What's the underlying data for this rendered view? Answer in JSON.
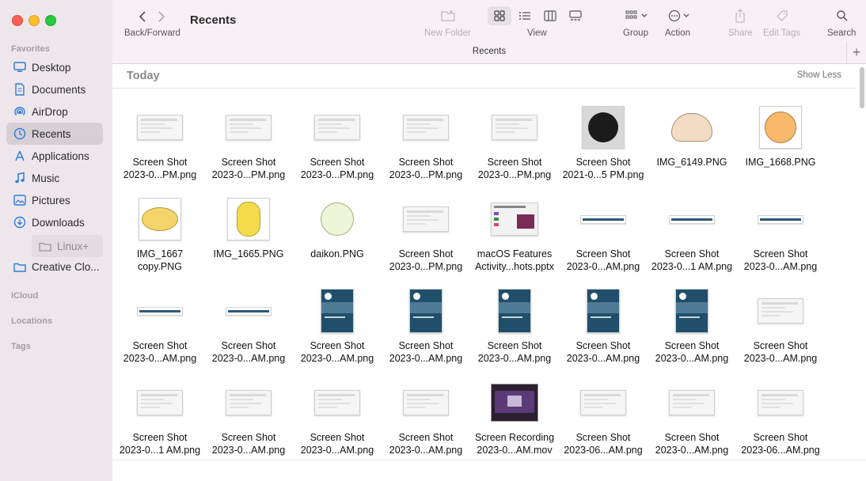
{
  "window": {
    "title": "Recents"
  },
  "colors": {
    "sidebar_bg": "#ede7ec",
    "accent": "#2f7bd9",
    "close": "#fe5f57",
    "minimize": "#febc2e",
    "zoom": "#28c840"
  },
  "sidebar": {
    "favorites_header": "Favorites",
    "items": [
      {
        "label": "Desktop",
        "icon": "desktop-icon"
      },
      {
        "label": "Documents",
        "icon": "document-icon"
      },
      {
        "label": "AirDrop",
        "icon": "airdrop-icon"
      },
      {
        "label": "Recents",
        "icon": "clock-icon",
        "selected": true
      },
      {
        "label": "Applications",
        "icon": "applications-icon"
      },
      {
        "label": "Music",
        "icon": "music-note-icon"
      },
      {
        "label": "Pictures",
        "icon": "photo-icon"
      },
      {
        "label": "Downloads",
        "icon": "download-icon"
      },
      {
        "label": "Linux+",
        "icon": "folder-icon",
        "dimmed": true
      },
      {
        "label": "Creative Clo...",
        "icon": "folder-icon"
      }
    ],
    "icloud_header": "iCloud",
    "locations_header": "Locations",
    "tags_header": "Tags"
  },
  "toolbar": {
    "title": "Recents",
    "back_forward_label": "Back/Forward",
    "new_folder_label": "New Folder",
    "view_label": "View",
    "group_label": "Group",
    "action_label": "Action",
    "share_label": "Share",
    "edit_tags_label": "Edit Tags",
    "search_label": "Search",
    "tab_title": "Recents",
    "view_mode": "icon"
  },
  "content": {
    "section_title": "Today",
    "show_less": "Show Less",
    "files": [
      {
        "line1": "Screen Shot",
        "line2": "2023-0...PM.png",
        "thumb": "shot"
      },
      {
        "line1": "Screen Shot",
        "line2": "2023-0...PM.png",
        "thumb": "shot"
      },
      {
        "line1": "Screen Shot",
        "line2": "2023-0...PM.png",
        "thumb": "shot"
      },
      {
        "line1": "Screen Shot",
        "line2": "2023-0...PM.png",
        "thumb": "shot"
      },
      {
        "line1": "Screen Shot",
        "line2": "2023-0...PM.png",
        "thumb": "shot"
      },
      {
        "line1": "Screen Shot",
        "line2": "2021-0...5 PM.png",
        "thumb": "logo"
      },
      {
        "line1": "IMG_6149.PNG",
        "line2": "",
        "thumb": "mushroom"
      },
      {
        "line1": "IMG_1668.PNG",
        "line2": "",
        "thumb": "onion"
      },
      {
        "line1": "IMG_1667",
        "line2": "copy.PNG",
        "thumb": "potato"
      },
      {
        "line1": "IMG_1665.PNG",
        "line2": "",
        "thumb": "banana"
      },
      {
        "line1": "daikon.PNG",
        "line2": "",
        "thumb": "daikon"
      },
      {
        "line1": "Screen Shot",
        "line2": "2023-0...PM.png",
        "thumb": "shot"
      },
      {
        "line1": "macOS Features",
        "line2": "Activity...hots.pptx",
        "thumb": "pptx"
      },
      {
        "line1": "Screen Shot",
        "line2": "2023-0...AM.png",
        "thumb": "strip"
      },
      {
        "line1": "Screen Shot",
        "line2": "2023-0...1 AM.png",
        "thumb": "strip"
      },
      {
        "line1": "Screen Shot",
        "line2": "2023-0...AM.png",
        "thumb": "strip"
      },
      {
        "line1": "Screen Shot",
        "line2": "2023-0...AM.png",
        "thumb": "strip"
      },
      {
        "line1": "Screen Shot",
        "line2": "2023-0...AM.png",
        "thumb": "strip"
      },
      {
        "line1": "Screen Shot",
        "line2": "2023-0...AM.png",
        "thumb": "doc"
      },
      {
        "line1": "Screen Shot",
        "line2": "2023-0...AM.png",
        "thumb": "doc"
      },
      {
        "line1": "Screen Shot",
        "line2": "2023-0...AM.png",
        "thumb": "doc"
      },
      {
        "line1": "Screen Shot",
        "line2": "2023-0...AM.png",
        "thumb": "doc"
      },
      {
        "line1": "Screen Shot",
        "line2": "2023-0...AM.png",
        "thumb": "doc"
      },
      {
        "line1": "Screen Shot",
        "line2": "2023-0...AM.png",
        "thumb": "shot"
      },
      {
        "line1": "Screen Shot",
        "line2": "2023-0...1 AM.png",
        "thumb": "shot"
      },
      {
        "line1": "Screen Shot",
        "line2": "2023-0...AM.png",
        "thumb": "shot"
      },
      {
        "line1": "Screen Shot",
        "line2": "2023-0...AM.png",
        "thumb": "shot"
      },
      {
        "line1": "Screen Shot",
        "line2": "2023-0...AM.png",
        "thumb": "shot"
      },
      {
        "line1": "Screen Recording",
        "line2": "2023-0...AM.mov",
        "thumb": "mov"
      },
      {
        "line1": "Screen Shot",
        "line2": "2023-06...AM.png",
        "thumb": "shot"
      },
      {
        "line1": "Screen Shot",
        "line2": "2023-0...AM.png",
        "thumb": "shot"
      },
      {
        "line1": "Screen Shot",
        "line2": "2023-06...AM.png",
        "thumb": "shot"
      }
    ]
  }
}
